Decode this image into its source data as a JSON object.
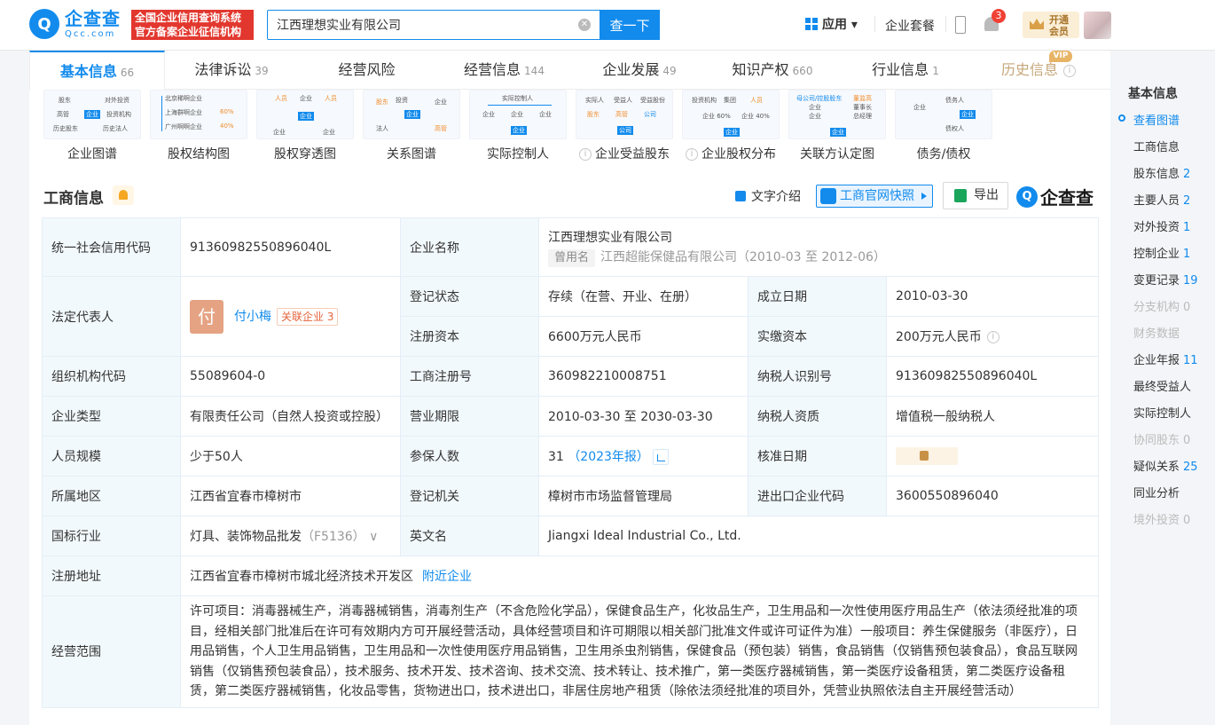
{
  "header": {
    "logo_text": "企查查",
    "logo_sub": "Qcc.com",
    "logo_badge": "Q",
    "slogan_line1": "全国企业信用查询系统",
    "slogan_line2": "官方备案企业征信机构",
    "search_value": "江西理想实业有限公司",
    "search_button": "查一下",
    "app_label": "应用 ▾",
    "suite_label": "企业套餐",
    "notification_count": "3",
    "vip_line1": "开通",
    "vip_line2": "会员"
  },
  "tabs": [
    {
      "label": "基本信息",
      "count": "66"
    },
    {
      "label": "法律诉讼",
      "count": "39"
    },
    {
      "label": "经营风险",
      "count": ""
    },
    {
      "label": "经营信息",
      "count": "144"
    },
    {
      "label": "企业发展",
      "count": "49"
    },
    {
      "label": "知识产权",
      "count": "660"
    },
    {
      "label": "行业信息",
      "count": "1"
    },
    {
      "label": "历史信息",
      "count": ""
    }
  ],
  "vip_tag": "VIP",
  "graph_cards": [
    {
      "label": "企业图谱",
      "info": false
    },
    {
      "label": "股权结构图",
      "info": false
    },
    {
      "label": "股权穿透图",
      "info": false
    },
    {
      "label": "关系图谱",
      "info": false
    },
    {
      "label": "实际控制人",
      "info": false
    },
    {
      "label": "企业受益股东",
      "info": true
    },
    {
      "label": "企业股权分布",
      "info": true
    },
    {
      "label": "关联方认定图",
      "info": false
    },
    {
      "label": "债务/债权",
      "info": false
    }
  ],
  "thumb_text": {
    "t1": [
      "股东",
      "对外投资",
      "高管",
      "企业",
      "投资机构",
      "历史股东",
      "历史法人"
    ],
    "t2": [
      "北京稀啊企业",
      "上海群啊企业",
      "广州啊啊企业",
      "60%",
      "40%"
    ],
    "t3": [
      "人员",
      "企业",
      "人员",
      "企业",
      "企业",
      "企业"
    ],
    "t4": [
      "股东",
      "投资",
      "企业",
      "法人",
      "高管",
      "投资"
    ],
    "t5": [
      "实际控制人",
      "企业",
      "企业",
      "企业"
    ],
    "t6": [
      "实际人",
      "受益人",
      "受益股份",
      "股东",
      "高管",
      "公司"
    ],
    "t7": [
      "投资机构",
      "集团",
      "人员",
      "企业 60%",
      "企业 40%",
      "企业"
    ],
    "t8": [
      "母公司/控股股东",
      "董监高",
      "企业",
      "董事长",
      "企业",
      "总经理",
      "企业"
    ],
    "t9": [
      "债务人",
      "企业",
      "企业",
      "债权人"
    ]
  },
  "section": {
    "title": "工商信息",
    "text_intro": "文字介绍",
    "snapshot": "工商官网快照",
    "export": "导出",
    "brand": "企查查",
    "brand_badge": "Q"
  },
  "info": {
    "credit_code_k": "统一社会信用代码",
    "credit_code_v": "91360982550896040L",
    "name_k": "企业名称",
    "name_v": "江西理想实业有限公司",
    "former_tag": "曾用名",
    "former_v": "江西超能保健品有限公司（2010-03 至 2012-06）",
    "legal_k": "法定代表人",
    "legal_face": "付",
    "legal_v": "付小梅",
    "related_label": "关联企业",
    "related_count": "3",
    "status_k": "登记状态",
    "status_v": "存续（在营、开业、在册）",
    "found_k": "成立日期",
    "found_v": "2010-03-30",
    "capital_k": "注册资本",
    "capital_v": "6600万元人民币",
    "paid_k": "实缴资本",
    "paid_v": "200万元人民币",
    "org_k": "组织机构代码",
    "org_v": "55089604-0",
    "reg_no_k": "工商注册号",
    "reg_no_v": "360982210008751",
    "tax_k": "纳税人识别号",
    "tax_v": "91360982550896040L",
    "type_k": "企业类型",
    "type_v": "有限责任公司（自然人投资或控股）",
    "term_k": "营业期限",
    "term_v": "2010-03-30 至 2030-03-30",
    "taxq_k": "纳税人资质",
    "taxq_v": "增值税一般纳税人",
    "size_k": "人员规模",
    "size_v": "少于50人",
    "insured_k": "参保人数",
    "insured_v": "31",
    "insured_year": "（2023年报）",
    "approve_k": "核准日期",
    "region_k": "所属地区",
    "region_v": "江西省宜春市樟树市",
    "authority_k": "登记机关",
    "authority_v": "樟树市市场监督管理局",
    "ie_k": "进出口企业代码",
    "ie_v": "3600550896040",
    "industry_k": "国标行业",
    "industry_v": "灯具、装饰物品批发",
    "industry_code": "（F5136）",
    "en_k": "英文名",
    "en_v": "Jiangxi Ideal Industrial Co., Ltd.",
    "addr_k": "注册地址",
    "addr_v": "江西省宜春市樟树市城北经济技术开发区",
    "addr_link": "附近企业",
    "scope_k": "经营范围",
    "scope_v": "许可项目：消毒器械生产，消毒器械销售，消毒剂生产（不含危险化学品），保健食品生产，化妆品生产，卫生用品和一次性使用医疗用品生产（依法须经批准的项目，经相关部门批准后在许可有效期内方可开展经营活动，具体经营项目和许可期限以相关部门批准文件或许可证件为准）一般项目：养生保健服务（非医疗），日用品销售，个人卫生用品销售，卫生用品和一次性使用医疗用品销售，卫生用杀虫剂销售，保健食品（预包装）销售，食品销售（仅销售预包装食品），食品互联网销售（仅销售预包装食品），技术服务、技术开发、技术咨询、技术交流、技术转让、技术推广，第一类医疗器械销售，第一类医疗设备租赁，第二类医疗设备租赁，第二类医疗器械销售，化妆品零售，货物进出口，技术进出口，非居住房地产租赁（除依法须经批准的项目外，凭营业执照依法自主开展经营活动）"
  },
  "right_nav": {
    "heading": "基本信息",
    "items": [
      {
        "label": "查看图谱",
        "count": "",
        "state": "cur"
      },
      {
        "label": "工商信息",
        "count": "",
        "state": ""
      },
      {
        "label": "股东信息",
        "count": "2",
        "state": ""
      },
      {
        "label": "主要人员",
        "count": "2",
        "state": ""
      },
      {
        "label": "对外投资",
        "count": "1",
        "state": ""
      },
      {
        "label": "控制企业",
        "count": "1",
        "state": ""
      },
      {
        "label": "变更记录",
        "count": "19",
        "state": ""
      },
      {
        "label": "分支机构",
        "count": "0",
        "state": "dis"
      },
      {
        "label": "财务数据",
        "count": "",
        "state": "dis"
      },
      {
        "label": "企业年报",
        "count": "11",
        "state": ""
      },
      {
        "label": "最终受益人",
        "count": "",
        "state": ""
      },
      {
        "label": "实际控制人",
        "count": "",
        "state": ""
      },
      {
        "label": "协同股东",
        "count": "0",
        "state": "dis"
      },
      {
        "label": "疑似关系",
        "count": "25",
        "state": ""
      },
      {
        "label": "同业分析",
        "count": "",
        "state": ""
      },
      {
        "label": "境外投资",
        "count": "0",
        "state": "dis"
      }
    ]
  }
}
